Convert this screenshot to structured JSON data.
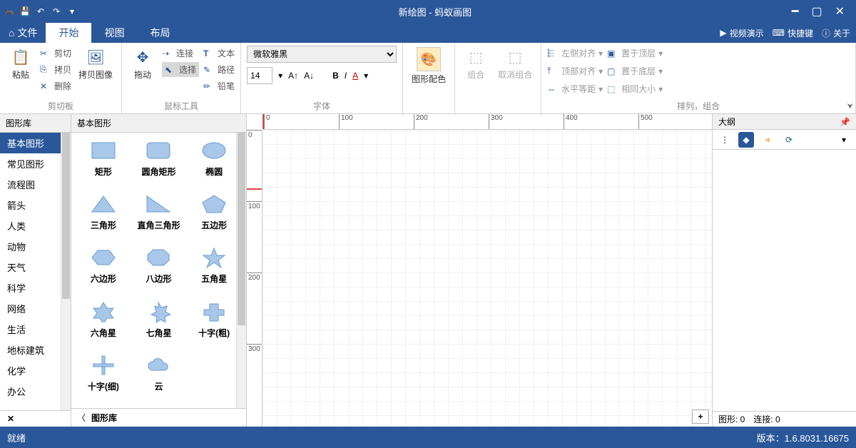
{
  "title": "新绘图 - 蚂蚁画图",
  "menu": {
    "file": "文件",
    "tabs": [
      "开始",
      "视图",
      "布局"
    ],
    "active_tab": 0,
    "right": {
      "video": "视频演示",
      "shortcut": "快捷键",
      "about": "关于"
    }
  },
  "ribbon": {
    "clipboard": {
      "label": "剪切板",
      "paste": "粘贴",
      "cut": "剪切",
      "copy": "拷贝",
      "delete": "删除",
      "image": "拷贝图像"
    },
    "mouse": {
      "label": "鼠标工具",
      "drag": "拖动",
      "connect": "连接",
      "select": "选择",
      "text": "文本",
      "path": "路径",
      "pencil": "铅笔"
    },
    "font": {
      "label": "字体",
      "family": "微软雅黑",
      "size": "14",
      "bold": "B",
      "italic": "I",
      "underline": "A"
    },
    "shapefill": {
      "label": "图形配色"
    },
    "group": {
      "combine": "组合",
      "ungroup": "取消组合"
    },
    "align": {
      "label": "排列，组合",
      "items": [
        "左侧对齐",
        "置于顶层",
        "顶部对齐",
        "置于底层",
        "水平等距",
        "相同大小"
      ]
    }
  },
  "left": {
    "header": "图形库",
    "categories": [
      "基本图形",
      "常见图形",
      "流程图",
      "箭头",
      "人类",
      "动物",
      "天气",
      "科学",
      "网络",
      "生活",
      "地标建筑",
      "化学",
      "办公"
    ],
    "active": 0
  },
  "shapes": {
    "header": "基本图形",
    "footer": "图形库",
    "items": [
      {
        "label": "矩形",
        "shape": "rect"
      },
      {
        "label": "圆角矩形",
        "shape": "roundrect"
      },
      {
        "label": "椭圆",
        "shape": "ellipse"
      },
      {
        "label": "三角形",
        "shape": "triangle"
      },
      {
        "label": "直角三角形",
        "shape": "righttriangle"
      },
      {
        "label": "五边形",
        "shape": "pentagon"
      },
      {
        "label": "六边形",
        "shape": "hexagon"
      },
      {
        "label": "八边形",
        "shape": "octagon"
      },
      {
        "label": "五角星",
        "shape": "star5"
      },
      {
        "label": "六角星",
        "shape": "star6"
      },
      {
        "label": "七角星",
        "shape": "star7"
      },
      {
        "label": "十字(粗)",
        "shape": "crossbold"
      },
      {
        "label": "十字(细)",
        "shape": "crossthin"
      },
      {
        "label": "云",
        "shape": "cloud"
      }
    ]
  },
  "outline": {
    "header": "大纲"
  },
  "ruler_marks": [
    0,
    100,
    200,
    300,
    400,
    500
  ],
  "vruler_marks": [
    0,
    100,
    200,
    300
  ],
  "right_footer": {
    "shapes": "图形: 0",
    "connects": "连接: 0"
  },
  "status": {
    "ready": "就绪",
    "version": "版本：1.6.8031.16675"
  }
}
